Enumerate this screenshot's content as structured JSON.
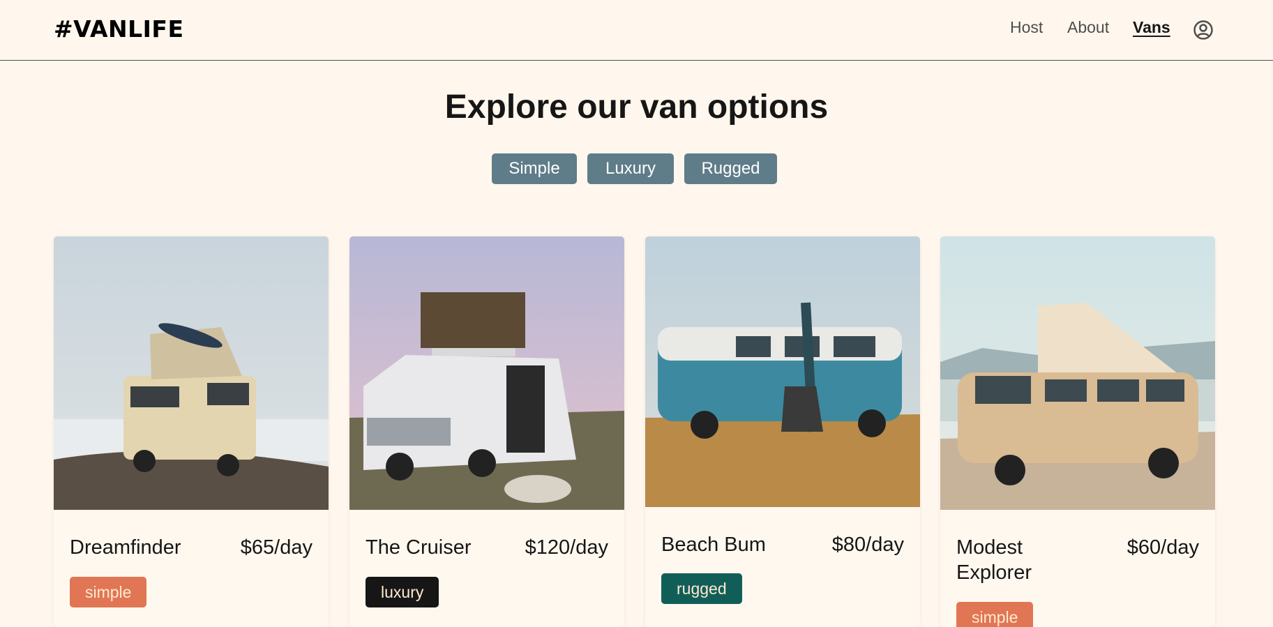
{
  "header": {
    "logo": "#VANLIFE",
    "nav": [
      {
        "label": "Host"
      },
      {
        "label": "About"
      },
      {
        "label": "Vans"
      }
    ],
    "user_icon": "user-circle-icon"
  },
  "main": {
    "title": "Explore our van options",
    "filters": [
      {
        "label": "Simple"
      },
      {
        "label": "Luxury"
      },
      {
        "label": "Rugged"
      }
    ],
    "vans": [
      {
        "name": "Dreamfinder",
        "price": "$65/day",
        "type": "simple"
      },
      {
        "name": "The Cruiser",
        "price": "$120/day",
        "type": "luxury"
      },
      {
        "name": "Beach Bum",
        "price": "$80/day",
        "type": "rugged"
      },
      {
        "name": "Modest Explorer",
        "price": "$60/day",
        "type": "simple"
      }
    ]
  },
  "colors": {
    "background": "#fff7ed",
    "filter_button": "#5f7c89",
    "simple": "#e17654",
    "luxury": "#161616",
    "rugged": "#115e59"
  }
}
